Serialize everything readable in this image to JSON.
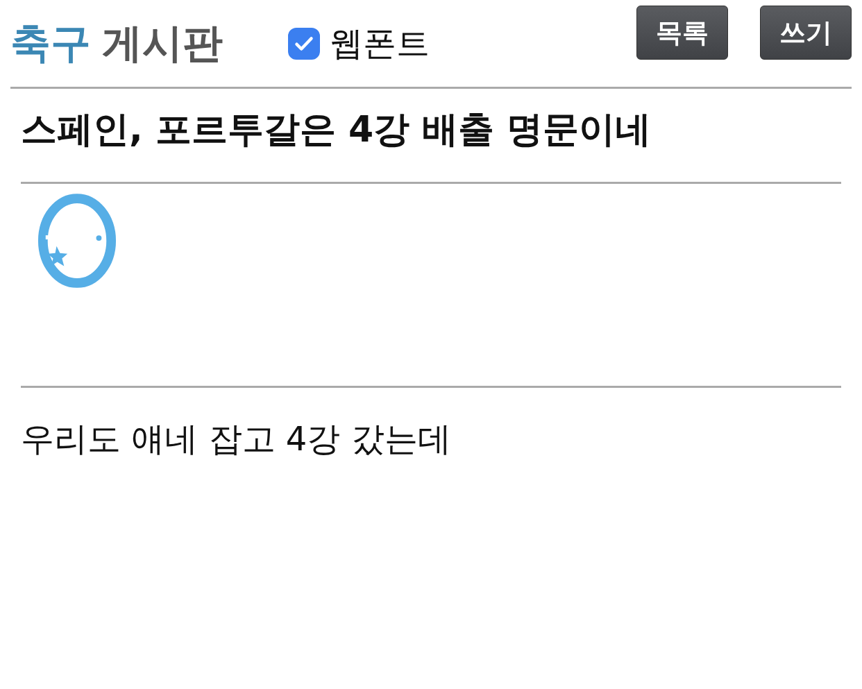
{
  "header": {
    "category": "축구",
    "board": "게시판",
    "webfont": {
      "label": "웹폰트",
      "checked": true
    },
    "buttons": [
      "목록",
      "쓰기"
    ]
  },
  "post": {
    "title": "스페인, 포르투갈은 4강 배출 명문이네",
    "body": "우리도 얘네 잡고 4강 갔는데"
  }
}
